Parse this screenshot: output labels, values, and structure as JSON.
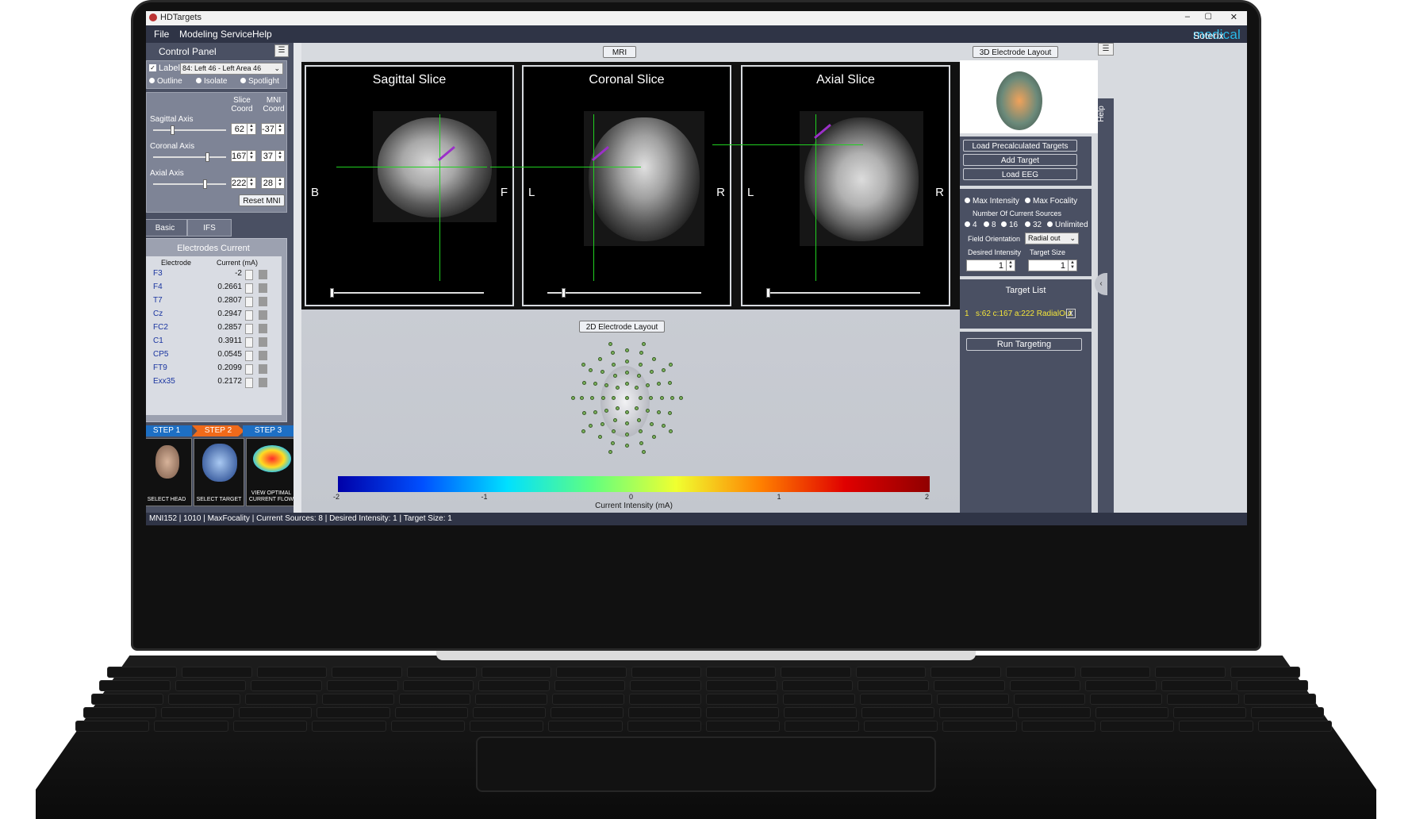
{
  "window": {
    "title": "HDTargets",
    "controls": [
      "–",
      "▢",
      "✕"
    ]
  },
  "menu": {
    "file": "File",
    "modeling": "Modeling Service",
    "help": "Help"
  },
  "brand": {
    "part1": "Soterix",
    "part2": "medical"
  },
  "control_panel": {
    "title": "Control Panel",
    "label_prefix": "Label:",
    "label_value": "84: Left 46 - Left Area 46",
    "modes": [
      "Outline",
      "Isolate",
      "Spotlight"
    ],
    "header_slice": "Slice Coord",
    "header_mni": "MNI Coord",
    "axes": [
      {
        "name": "Sagittal Axis",
        "slice": "62",
        "mni": "-37",
        "level": 0.25
      },
      {
        "name": "Coronal Axis",
        "slice": "167",
        "mni": "37",
        "level": 0.75
      },
      {
        "name": "Axial Axis",
        "slice": "222",
        "mni": "28",
        "level": 0.72
      }
    ],
    "reset_label": "Reset MNI",
    "tabs": [
      "Basic",
      "IFS"
    ],
    "electrodes": {
      "title": "Electrodes Current",
      "col_electrode": "Electrode",
      "col_current": "Current (mA)",
      "rows": [
        {
          "e": "F3",
          "c": "-2"
        },
        {
          "e": "F4",
          "c": "0.2661"
        },
        {
          "e": "T7",
          "c": "0.2807"
        },
        {
          "e": "Cz",
          "c": "0.2947"
        },
        {
          "e": "FC2",
          "c": "0.2857"
        },
        {
          "e": "C1",
          "c": "0.3911"
        },
        {
          "e": "CP5",
          "c": "0.0545"
        },
        {
          "e": "FT9",
          "c": "0.2099"
        },
        {
          "e": "Exx35",
          "c": "0.2172"
        }
      ]
    },
    "steps": [
      "STEP 1",
      "STEP 2",
      "STEP 3"
    ],
    "step_cards": [
      "SELECT HEAD",
      "SELECT TARGET",
      "VIEW OPTIMAL CURRENT FLOW"
    ]
  },
  "center": {
    "mri_button": "MRI",
    "views": [
      {
        "title": "Sagittal Slice",
        "left": "B",
        "right": "F"
      },
      {
        "title": "Coronal Slice",
        "left": "L",
        "right": "R"
      },
      {
        "title": "Axial Slice",
        "left": "L",
        "right": "R"
      }
    ],
    "layout2d_button": "2D Electrode Layout",
    "colorbar": {
      "ticks": [
        "-2",
        "-1",
        "0",
        "1",
        "2"
      ],
      "label": "Current Intensity (mA)",
      "colors": [
        "#0000a8",
        "#0050ff",
        "#00e0ff",
        "#60ff80",
        "#f0ff30",
        "#ff8000",
        "#e00000",
        "#900000"
      ]
    }
  },
  "right": {
    "layout3d_button": "3D Electrode Layout",
    "help_tab": "Help",
    "buttons": [
      "Load Precalculated Targets",
      "Add Target",
      "Load EEG"
    ],
    "opt_modes": [
      "Max Intensity",
      "Max Focality"
    ],
    "num_sources_label": "Number Of Current Sources",
    "num_sources": [
      "4",
      "8",
      "16",
      "32",
      "Unlimited"
    ],
    "field_orientation_label": "Field Orientation",
    "field_orientation_value": "Radial out",
    "desired_intensity_label": "Desired Intensity",
    "target_size_label": "Target Size",
    "desired_intensity": "1",
    "target_size": "1",
    "target_list_title": "Target List",
    "target_index": "1",
    "target_entry": "s:62 c:167 a:222 RadialOut",
    "remove": "X",
    "run_button": "Run Targeting"
  },
  "status": "MNI152 | 1010 | MaxFocality | Current Sources: 8 | Desired Intensity: 1 | Target Size: 1"
}
